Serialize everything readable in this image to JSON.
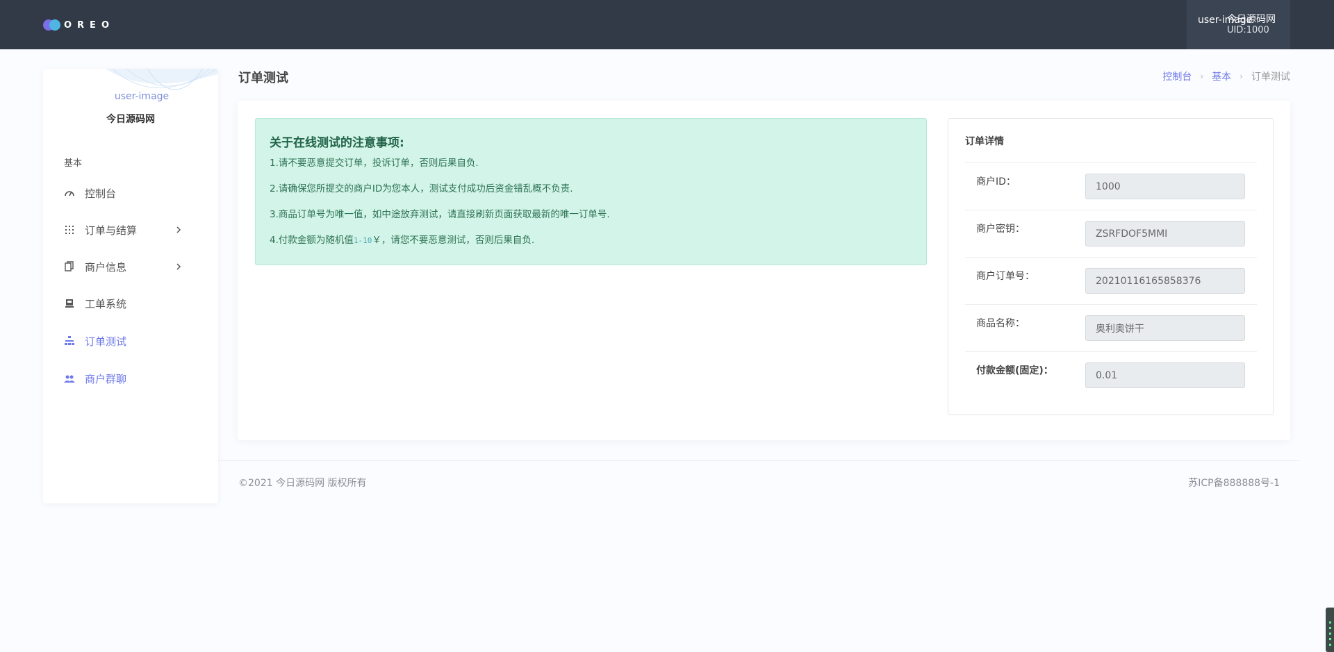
{
  "header": {
    "logo_text": "OREO",
    "user_image_alt": "user-image",
    "user_name": "今日源码网",
    "user_uid": "UID:1000"
  },
  "sidebar": {
    "profile_image_alt": "user-image",
    "profile_name": "今日源码网",
    "section_label": "基本",
    "items": [
      {
        "label": "控制台",
        "icon": "speedometer-icon",
        "has_submenu": false
      },
      {
        "label": "订单与结算",
        "icon": "grid-dots-icon",
        "has_submenu": true
      },
      {
        "label": "商户信息",
        "icon": "copy-document-icon",
        "has_submenu": true
      },
      {
        "label": "工单系统",
        "icon": "ticket-icon",
        "has_submenu": false
      },
      {
        "label": "订单测试",
        "icon": "sitemap-icon",
        "has_submenu": false,
        "active": true
      },
      {
        "label": "商户群聊",
        "icon": "people-icon",
        "has_submenu": false,
        "active": true
      }
    ]
  },
  "page": {
    "title": "订单测试",
    "breadcrumb": [
      "控制台",
      "基本",
      "订单测试"
    ]
  },
  "notice": {
    "title": "关于在线测试的注意事项:",
    "line1": "1.请不要恶意提交订单，投诉订单，否则后果自负.",
    "line2": "2.请确保您所提交的商户ID为您本人，测试支付成功后资金错乱概不负责.",
    "line3": "3.商品订单号为唯一值，如中途放弃测试，请直接刷新页面获取最新的唯一订单号.",
    "line4_prefix": "4.付款金额为随机值",
    "line4_code": "1-10",
    "line4_suffix": "￥，请您不要恶意测试，否则后果自负."
  },
  "order_detail": {
    "title": "订单详情",
    "fields": [
      {
        "label": "商户ID：",
        "value": "1000"
      },
      {
        "label": "商户密钥：",
        "value": "ZSRFDOF5MMI"
      },
      {
        "label": "商户订单号：",
        "value": "20210116165858376"
      },
      {
        "label": "商品名称：",
        "value": "奥利奥饼干"
      },
      {
        "label": "付款金额(固定)：",
        "value": "0.01"
      }
    ]
  },
  "footer": {
    "copyright": "©2021 今日源码网 版权所有",
    "icp": "苏ICP备888888号-1"
  },
  "colors": {
    "topbar": "#323a47",
    "accent": "#6e79e8",
    "notice_bg": "#d3f4e8",
    "notice_text": "#2d7356"
  }
}
